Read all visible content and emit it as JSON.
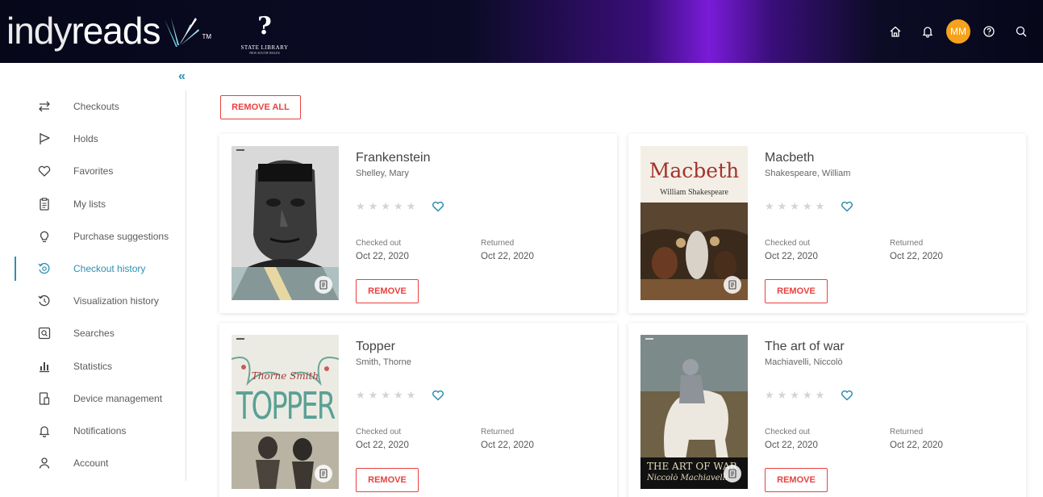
{
  "header": {
    "brand_light": "indy",
    "brand_bold": "reads",
    "brand_tm": "TM",
    "partner_mark": "?",
    "partner_name": "STATE LIBRARY",
    "partner_sub": "NEW SOUTH WALES",
    "avatar_initials": "MM",
    "avatar_color": "#f6a21c"
  },
  "sidebar": {
    "collapse_glyph": "«",
    "items": [
      {
        "label": "Checkouts",
        "icon": "swap-arrows-icon"
      },
      {
        "label": "Holds",
        "icon": "flag-icon"
      },
      {
        "label": "Favorites",
        "icon": "heart-icon"
      },
      {
        "label": "My lists",
        "icon": "clipboard-icon"
      },
      {
        "label": "Purchase suggestions",
        "icon": "lightbulb-icon"
      },
      {
        "label": "Checkout history",
        "icon": "history-icon",
        "active": true
      },
      {
        "label": "Visualization history",
        "icon": "view-history-icon"
      },
      {
        "label": "Searches",
        "icon": "search-box-icon"
      },
      {
        "label": "Statistics",
        "icon": "bar-chart-icon"
      },
      {
        "label": "Device management",
        "icon": "device-icon"
      },
      {
        "label": "Notifications",
        "icon": "bell-icon"
      },
      {
        "label": "Account",
        "icon": "user-icon"
      }
    ]
  },
  "main": {
    "remove_all_label": "REMOVE ALL",
    "remove_label": "REMOVE",
    "checked_out_label": "Checked out",
    "returned_label": "Returned",
    "books": [
      {
        "title": "Frankenstein",
        "author": "Shelley, Mary",
        "checked_out": "Oct 22, 2020",
        "returned": "Oct 22, 2020",
        "rating": 0
      },
      {
        "title": "Macbeth",
        "author": "Shakespeare, William",
        "checked_out": "Oct 22, 2020",
        "returned": "Oct 22, 2020",
        "rating": 0,
        "cover_title": "Macbeth",
        "cover_author": "William Shakespeare"
      },
      {
        "title": "Topper",
        "author": "Smith, Thorne",
        "checked_out": "Oct 22, 2020",
        "returned": "Oct 22, 2020",
        "rating": 0,
        "cover_title": "TOPPER",
        "cover_author": "Thorne Smith"
      },
      {
        "title": "The art of war",
        "author": "Machiavelli, Niccolò",
        "checked_out": "Oct 22, 2020",
        "returned": "Oct 22, 2020",
        "rating": 0,
        "cover_title": "THE ART OF WAR",
        "cover_author": "Niccolò Machiavelli"
      }
    ]
  },
  "colors": {
    "accent": "#2f8fb0",
    "danger": "#e8413e"
  }
}
